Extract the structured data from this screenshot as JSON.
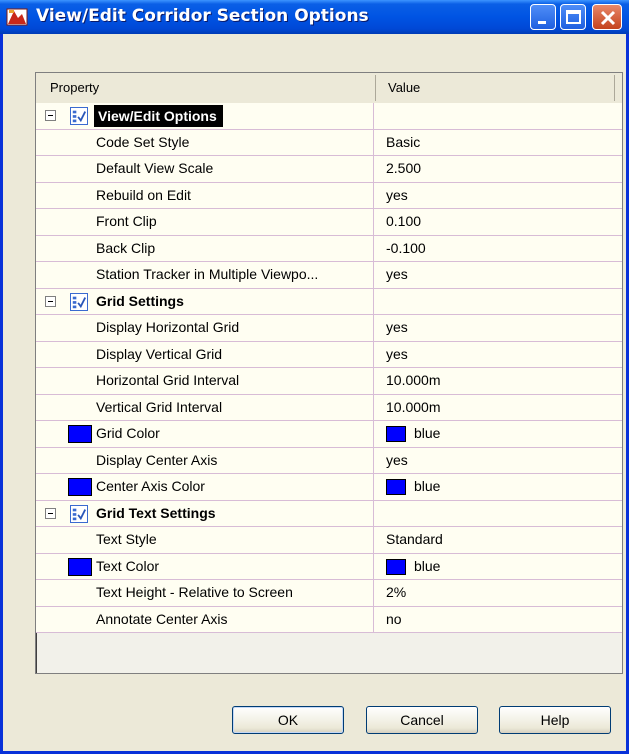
{
  "window": {
    "title": "View/Edit Corridor Section Options"
  },
  "grid": {
    "header": {
      "property": "Property",
      "value": "Value"
    },
    "rows": [
      {
        "kind": "category",
        "label": "View/Edit Options",
        "selected": true
      },
      {
        "kind": "item",
        "label": "Code Set Style",
        "value": "Basic"
      },
      {
        "kind": "item",
        "label": "Default View Scale",
        "value": "2.500"
      },
      {
        "kind": "item",
        "label": "Rebuild on Edit",
        "value": "yes"
      },
      {
        "kind": "item",
        "label": "Front Clip",
        "value": "0.100"
      },
      {
        "kind": "item",
        "label": "Back Clip",
        "value": "-0.100"
      },
      {
        "kind": "item",
        "label": "Station Tracker in Multiple Viewpo...",
        "value": "yes"
      },
      {
        "kind": "category",
        "label": "Grid Settings",
        "selected": false
      },
      {
        "kind": "item",
        "label": "Display Horizontal Grid",
        "value": "yes"
      },
      {
        "kind": "item",
        "label": "Display Vertical Grid",
        "value": "yes"
      },
      {
        "kind": "item",
        "label": "Horizontal Grid Interval",
        "value": "10.000m"
      },
      {
        "kind": "item",
        "label": "Vertical Grid Interval",
        "value": "10.000m"
      },
      {
        "kind": "color",
        "label": "Grid Color",
        "value": "blue",
        "color": "#0000ff"
      },
      {
        "kind": "item",
        "label": "Display Center Axis",
        "value": "yes"
      },
      {
        "kind": "color",
        "label": "Center Axis Color",
        "value": "blue",
        "color": "#0000ff"
      },
      {
        "kind": "category",
        "label": "Grid Text Settings",
        "selected": false
      },
      {
        "kind": "item",
        "label": "Text Style",
        "value": "Standard"
      },
      {
        "kind": "color",
        "label": "Text Color",
        "value": "blue",
        "color": "#0000ff"
      },
      {
        "kind": "item",
        "label": "Text Height - Relative to Screen",
        "value": "2%"
      },
      {
        "kind": "item",
        "label": "Annotate Center Axis",
        "value": "no"
      }
    ]
  },
  "buttons": {
    "ok": "OK",
    "cancel": "Cancel",
    "help": "Help"
  },
  "icons": {
    "app": "corridor-app-icon",
    "category": "property-category-icon"
  }
}
